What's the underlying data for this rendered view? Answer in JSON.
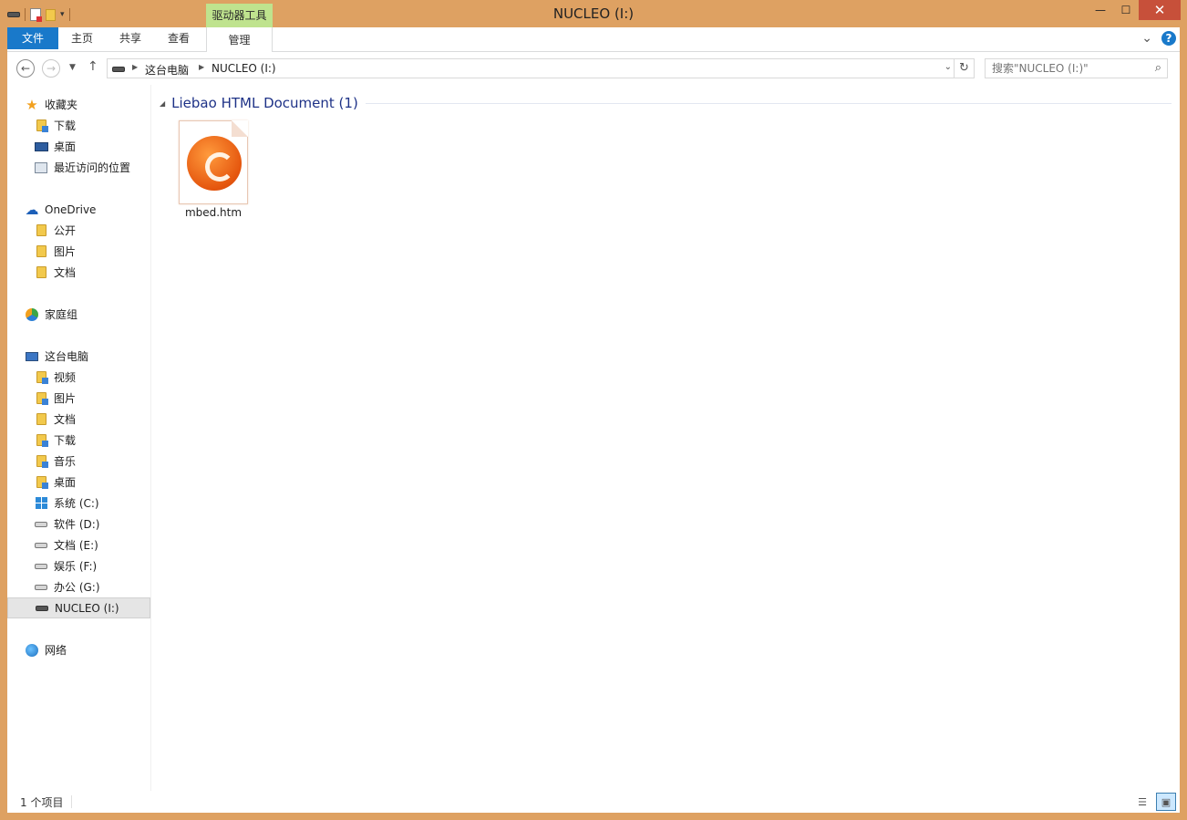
{
  "window": {
    "title": "NUCLEO (I:)",
    "context_tab_group": "驱动器工具",
    "minimize_glyph": "—",
    "maximize_glyph": "☐",
    "close_glyph": "✕"
  },
  "ribbon": {
    "tabs": [
      "文件",
      "主页",
      "共享",
      "查看",
      "管理"
    ],
    "expand_glyph": "⌄",
    "help_glyph": "?"
  },
  "address": {
    "back_glyph": "←",
    "forward_glyph": "→",
    "recent_glyph": "▼",
    "up_glyph": "↑",
    "crumbs": [
      "这台电脑",
      "NUCLEO (I:)"
    ],
    "crumb_sep": "▶",
    "dropdown_glyph": "⌄",
    "refresh_glyph": "↻"
  },
  "search": {
    "placeholder": "搜索\"NUCLEO (I:)\"",
    "icon_glyph": "⌕"
  },
  "navpane": {
    "favorites": "收藏夹",
    "favorites_items": [
      "下载",
      "桌面",
      "最近访问的位置"
    ],
    "onedrive": "OneDrive",
    "onedrive_items": [
      "公开",
      "图片",
      "文档"
    ],
    "homegroup": "家庭组",
    "thispc": "这台电脑",
    "thispc_items": [
      "视频",
      "图片",
      "文档",
      "下载",
      "音乐",
      "桌面",
      "系统 (C:)",
      "软件 (D:)",
      "文档 (E:)",
      "娱乐 (F:)",
      "办公 (G:)",
      "NUCLEO (I:)"
    ],
    "network": "网络"
  },
  "main": {
    "group_title": "Liebao HTML Document (1)",
    "group_toggle_glyph": "◢",
    "files": [
      {
        "name": "mbed.htm"
      }
    ]
  },
  "status": {
    "item_count": "1 个项目",
    "details_view_glyph": "☰",
    "icons_view_glyph": "▣"
  },
  "colors": {
    "frame": "#dea162",
    "file_tab": "#1979ca",
    "context_tab": "#bfe38e",
    "close_button": "#c7503a",
    "group_title": "#1e3287"
  }
}
